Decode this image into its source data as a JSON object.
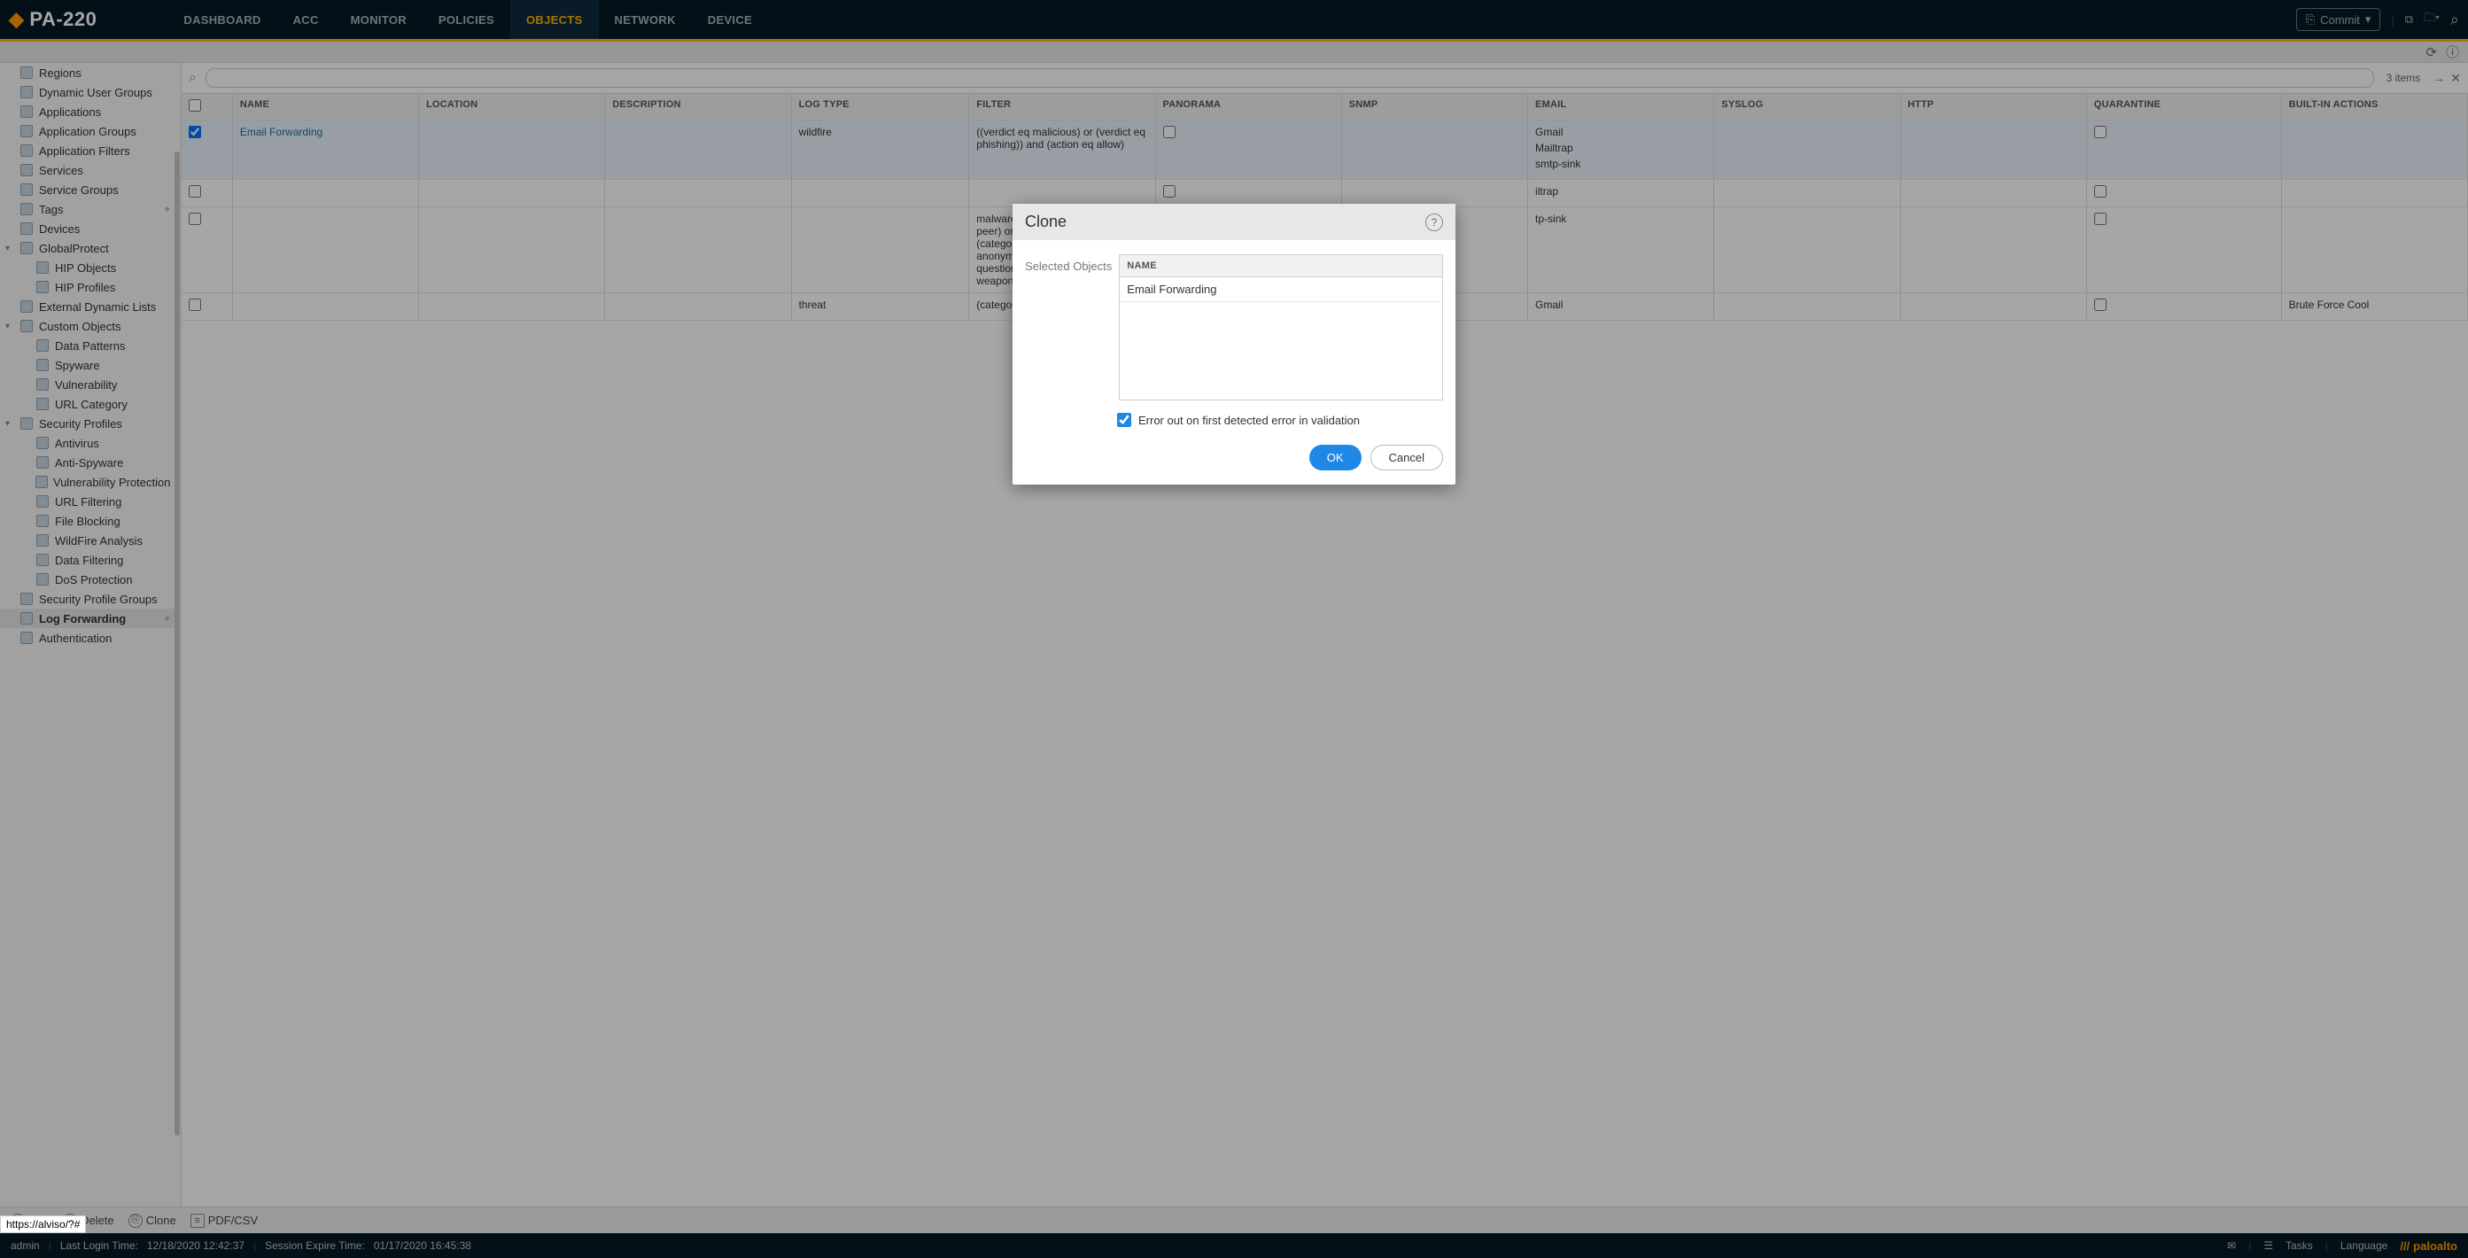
{
  "brand": {
    "model": "PA-220"
  },
  "nav": {
    "items": [
      "DASHBOARD",
      "ACC",
      "MONITOR",
      "POLICIES",
      "OBJECTS",
      "NETWORK",
      "DEVICE"
    ],
    "active_index": 4
  },
  "top_right": {
    "commit_label": "Commit"
  },
  "sidebar": {
    "items": [
      {
        "label": "Regions",
        "indent": 0
      },
      {
        "label": "Dynamic User Groups",
        "indent": 0
      },
      {
        "label": "Applications",
        "indent": 0
      },
      {
        "label": "Application Groups",
        "indent": 0
      },
      {
        "label": "Application Filters",
        "indent": 0
      },
      {
        "label": "Services",
        "indent": 0
      },
      {
        "label": "Service Groups",
        "indent": 0
      },
      {
        "label": "Tags",
        "indent": 0,
        "dot": true
      },
      {
        "label": "Devices",
        "indent": 0
      },
      {
        "label": "GlobalProtect",
        "indent": 0,
        "expandable": true,
        "expanded": true
      },
      {
        "label": "HIP Objects",
        "indent": 1
      },
      {
        "label": "HIP Profiles",
        "indent": 1
      },
      {
        "label": "External Dynamic Lists",
        "indent": 0
      },
      {
        "label": "Custom Objects",
        "indent": 0,
        "expandable": true,
        "expanded": true
      },
      {
        "label": "Data Patterns",
        "indent": 1
      },
      {
        "label": "Spyware",
        "indent": 1
      },
      {
        "label": "Vulnerability",
        "indent": 1
      },
      {
        "label": "URL Category",
        "indent": 1
      },
      {
        "label": "Security Profiles",
        "indent": 0,
        "expandable": true,
        "expanded": true
      },
      {
        "label": "Antivirus",
        "indent": 1
      },
      {
        "label": "Anti-Spyware",
        "indent": 1
      },
      {
        "label": "Vulnerability Protection",
        "indent": 1
      },
      {
        "label": "URL Filtering",
        "indent": 1
      },
      {
        "label": "File Blocking",
        "indent": 1
      },
      {
        "label": "WildFire Analysis",
        "indent": 1
      },
      {
        "label": "Data Filtering",
        "indent": 1
      },
      {
        "label": "DoS Protection",
        "indent": 1
      },
      {
        "label": "Security Profile Groups",
        "indent": 0
      },
      {
        "label": "Log Forwarding",
        "indent": 0,
        "selected": true,
        "dot": true
      },
      {
        "label": "Authentication",
        "indent": 0
      }
    ]
  },
  "grid": {
    "items_count_label": "3 items",
    "columns": [
      "NAME",
      "LOCATION",
      "DESCRIPTION",
      "LOG TYPE",
      "FILTER",
      "PANORAMA",
      "SNMP",
      "EMAIL",
      "SYSLOG",
      "HTTP",
      "QUARANTINE",
      "BUILT-IN ACTIONS"
    ],
    "rows": [
      {
        "selected": true,
        "name": "Email Forwarding",
        "location": "",
        "description": "",
        "log_type": "wildfire",
        "filter": "((verdict eq malicious) or (verdict eq phishing)) and (action eq allow)",
        "panorama_checked": false,
        "snmp": "",
        "email": [
          "Gmail",
          "Mailtrap",
          "smtp-sink"
        ],
        "syslog": "",
        "http": "",
        "quarantine_checked": false,
        "builtin_actions": ""
      },
      {
        "selected": false,
        "name": "",
        "location": "",
        "description": "",
        "log_type": "",
        "filter": "",
        "panorama_checked": false,
        "snmp": "",
        "email": [
          "iltrap"
        ],
        "syslog": "",
        "http": "",
        "quarantine_checked": false,
        "builtin_actions": ""
      },
      {
        "selected": false,
        "name": "",
        "location": "",
        "description": "",
        "log_type": "",
        "filter": "malware) or (category eq peer-to-peer) or (category eq phishing) or (category eq proxy-avoidance-and-anonymizers) or (category eq questionable) or (category eq weapons)",
        "panorama_checked": false,
        "snmp": "",
        "email": [
          "tp-sink"
        ],
        "syslog": "",
        "http": "",
        "quarantine_checked": false,
        "builtin_actions": ""
      },
      {
        "selected": false,
        "name": "",
        "location": "",
        "description": "",
        "log_type": "threat",
        "filter": "(category-of-",
        "panorama_checked": false,
        "snmp": "",
        "email": [
          "Gmail"
        ],
        "syslog": "",
        "http": "",
        "quarantine_checked": false,
        "builtin_actions": "Brute Force Cool"
      }
    ]
  },
  "toolbar": {
    "add": "Add",
    "delete": "Delete",
    "clone": "Clone",
    "pdfcsv": "PDF/CSV"
  },
  "status": {
    "admin": "admin",
    "last_login_label": "Last Login Time:",
    "last_login_value": "12/18/2020 12:42:37",
    "expire_label": "Session Expire Time:",
    "expire_value": "01/17/2020 16:45:38",
    "tasks_label": "Tasks",
    "language_label": "Language",
    "brand_footer": "paloalto"
  },
  "url_hover": "https://alviso/?#",
  "modal": {
    "title": "Clone",
    "selected_objects_label": "Selected Objects",
    "column_header": "NAME",
    "rows": [
      "Email Forwarding"
    ],
    "error_checkbox_label": "Error out on first detected error in validation",
    "error_checkbox_checked": true,
    "ok_label": "OK",
    "cancel_label": "Cancel"
  }
}
